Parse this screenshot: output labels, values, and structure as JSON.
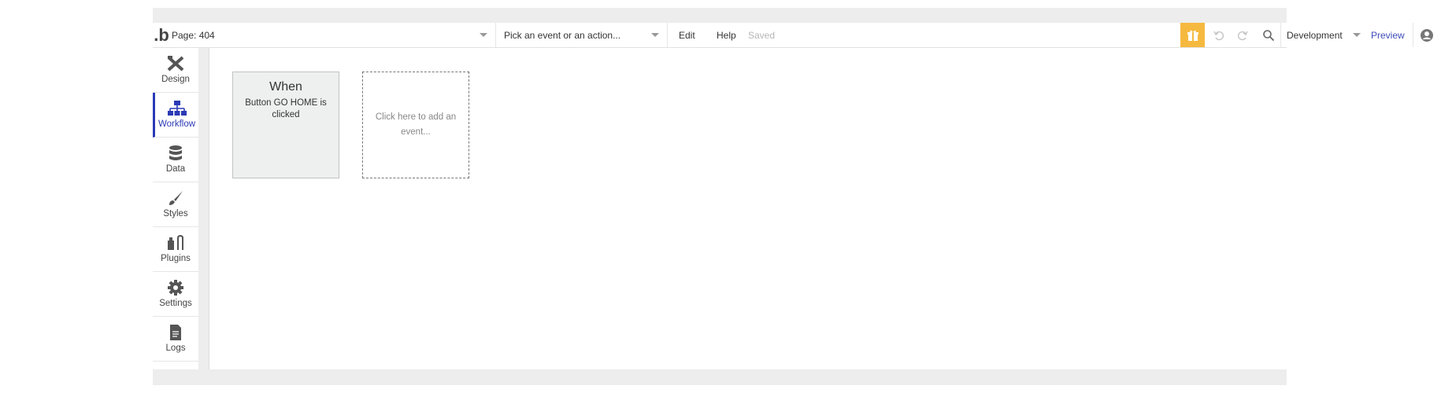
{
  "topbar": {
    "logo": ".b",
    "page_selector": "Page: 404",
    "event_selector": "Pick an event or an action...",
    "menu_edit": "Edit",
    "menu_help": "Help",
    "save_status": "Saved",
    "environment": "Development",
    "preview": "Preview",
    "icons": [
      "gift-icon",
      "undo-icon",
      "redo-icon",
      "search-icon",
      "account-icon"
    ]
  },
  "sidebar": {
    "items": [
      {
        "label": "Design",
        "icon": "design-icon"
      },
      {
        "label": "Workflow",
        "icon": "workflow-icon",
        "active": true
      },
      {
        "label": "Data",
        "icon": "database-icon"
      },
      {
        "label": "Styles",
        "icon": "brush-icon"
      },
      {
        "label": "Plugins",
        "icon": "plugins-icon"
      },
      {
        "label": "Settings",
        "icon": "gear-icon"
      },
      {
        "label": "Logs",
        "icon": "document-icon"
      }
    ]
  },
  "workflow": {
    "event_card": {
      "title": "When",
      "description": "Button GO HOME is clicked"
    },
    "add_event_text": "Click here to add an event..."
  },
  "colors": {
    "accent": "#2b3ab5",
    "gift": "#f6b940",
    "preview_link": "#3d4cb8"
  }
}
